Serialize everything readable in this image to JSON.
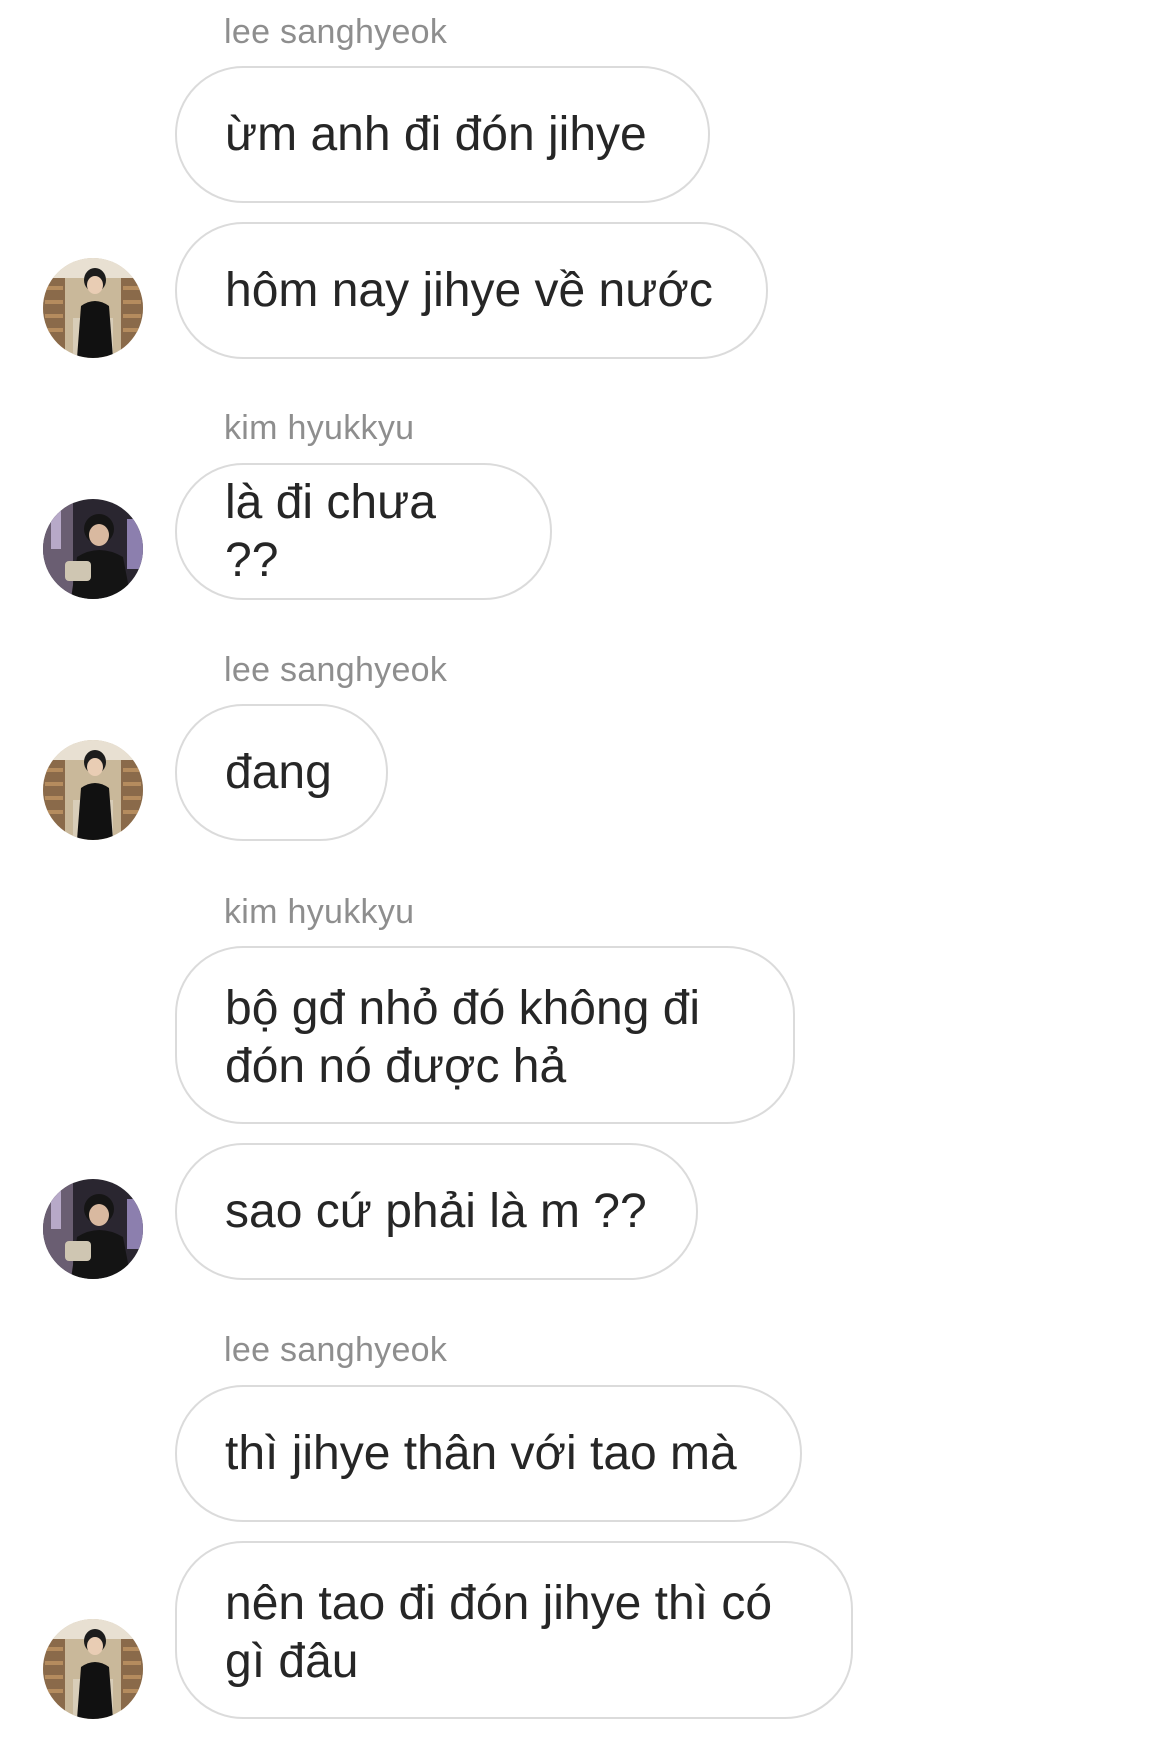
{
  "messages": [
    {
      "type": "sender",
      "text": "lee sanghyeok"
    },
    {
      "type": "message",
      "text": "ừm anh đi đón jihye"
    },
    {
      "type": "message",
      "text": "hôm nay jihye về nước",
      "avatar": "lee-sanghyeok-avatar"
    },
    {
      "type": "sender",
      "text": "kim hyukkyu"
    },
    {
      "type": "message",
      "text": "là đi chưa ??",
      "avatar": "kim-hyukkyu-avatar"
    },
    {
      "type": "sender",
      "text": "lee sanghyeok"
    },
    {
      "type": "message",
      "text": "đang",
      "avatar": "lee-sanghyeok-avatar"
    },
    {
      "type": "sender",
      "text": "kim hyukkyu"
    },
    {
      "type": "message",
      "text": "bộ gđ nhỏ đó không đi\nđón nó được hả"
    },
    {
      "type": "message",
      "text": "sao cứ phải là m ??",
      "avatar": "kim-hyukkyu-avatar"
    },
    {
      "type": "sender",
      "text": "lee sanghyeok"
    },
    {
      "type": "message",
      "text": "thì jihye thân với tao mà"
    },
    {
      "type": "message",
      "text": "nên tao đi đón jihye thì có\ngì đâu",
      "avatar": "lee-sanghyeok-avatar"
    }
  ],
  "colors": {
    "bubble_border": "#dbdbdb",
    "sender_text": "#8e8e8e",
    "message_text": "#262626",
    "background": "#ffffff"
  }
}
